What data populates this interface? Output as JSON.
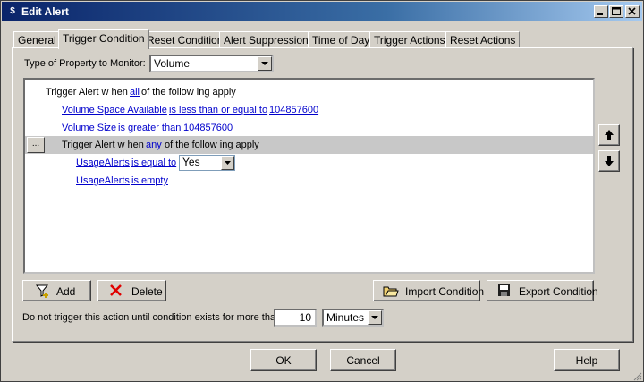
{
  "window": {
    "title": "Edit Alert"
  },
  "tabs": [
    "General",
    "Trigger Condition",
    "Reset Condition",
    "Alert Suppression",
    "Time of Day",
    "Trigger Actions",
    "Reset Actions"
  ],
  "property": {
    "label": "Type of Property to Monitor:",
    "value": "Volume"
  },
  "tree": {
    "root": {
      "prefix": "Trigger Alert w hen",
      "quantifier": "all",
      "suffix": "of the follow ing apply"
    },
    "cond1": {
      "field": "Volume Space Available",
      "op": "is less than or equal to",
      "value": "104857600"
    },
    "cond2": {
      "field": "Volume Size",
      "op": "is greater than",
      "value": "104857600"
    },
    "group": {
      "ellipsis": "...",
      "prefix": "Trigger Alert w hen",
      "quantifier": "any",
      "suffix": "of the follow ing apply"
    },
    "cond3": {
      "field": "UsageAlerts",
      "op": "is equal to",
      "value": "Yes"
    },
    "cond4": {
      "field": "UsageAlerts",
      "op": "is empty"
    }
  },
  "buttons": {
    "add": "Add",
    "delete": "Delete",
    "import": "Import Condition",
    "export": "Export Condition",
    "ok": "OK",
    "cancel": "Cancel",
    "help": "Help"
  },
  "duration": {
    "label": "Do not trigger this action until condition exists for more than",
    "value": "10",
    "unit": "Minutes"
  },
  "icons": [
    "app-icon",
    "minimize-icon",
    "maximize-icon",
    "close-icon",
    "move-up-icon",
    "move-down-icon",
    "add-filter-icon",
    "delete-icon",
    "import-folder-icon",
    "save-disk-icon"
  ]
}
